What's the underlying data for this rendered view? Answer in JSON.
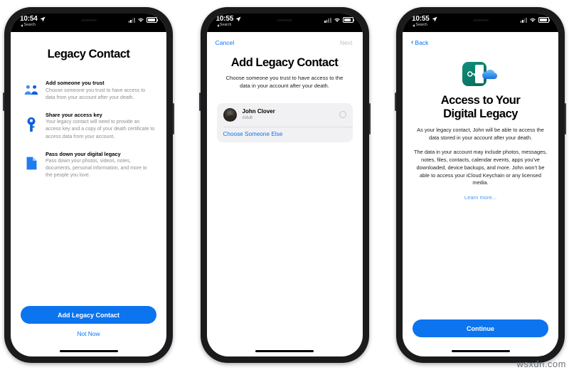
{
  "watermark": "wsxdn.com",
  "colors": {
    "accent": "#0b74ee",
    "link": "#0a74f0",
    "muted": "#8e8e93",
    "card_bg": "#f1f1f3",
    "badge_green": "#0f8f7a",
    "cloud_blue": "#2a8cf0"
  },
  "phones": [
    {
      "status": {
        "time": "10:54",
        "back_label": "Search",
        "location_icon": "location-arrow-icon",
        "signal_icon": "cellular-signal-icon",
        "wifi_icon": "wifi-icon",
        "battery_icon": "battery-icon"
      },
      "title": "Legacy Contact",
      "features": [
        {
          "icon": "two-people-icon",
          "heading": "Add someone you trust",
          "description": "Choose someone you trust to have access to data from your account after your death."
        },
        {
          "icon": "key-icon",
          "heading": "Share your access key",
          "description": "Your legacy contact will need to provide an access key and a copy of your death certificate to access data from your account."
        },
        {
          "icon": "document-icon",
          "heading": "Pass down your digital legacy",
          "description": "Pass down your photos, videos, notes, documents, personal information, and more to the people you love."
        }
      ],
      "primary_button": "Add Legacy Contact",
      "secondary_button": "Not Now"
    },
    {
      "status": {
        "time": "10:55",
        "back_label": "Search",
        "location_icon": "location-arrow-icon",
        "signal_icon": "cellular-signal-icon",
        "wifi_icon": "wifi-icon",
        "battery_icon": "battery-icon"
      },
      "nav_left": "Cancel",
      "nav_right": "Next",
      "title": "Add Legacy Contact",
      "subtitle": "Choose someone you trust to have access to the data in your account after your death.",
      "contact": {
        "name": "John Clover",
        "subtitle": "Adult",
        "avatar": "contact-avatar",
        "selector": "radio-unselected-icon"
      },
      "card_link": "Choose Someone Else"
    },
    {
      "status": {
        "time": "10:55",
        "back_label": "Search",
        "location_icon": "location-arrow-icon",
        "signal_icon": "cellular-signal-icon",
        "wifi_icon": "wifi-icon",
        "battery_icon": "battery-icon"
      },
      "nav_left": "Back",
      "hero_icon": "legacy-key-cloud-icon",
      "title_line1": "Access to Your",
      "title_line2": "Digital Legacy",
      "paragraph1": "As your legacy contact, John will be able to access the data stored in your account after your death.",
      "paragraph2": "The data in your account may include photos, messages, notes, files, contacts, calendar events, apps you’ve downloaded, device backups, and more. John won’t be able to access your iCloud Keychain or any licensed media.",
      "learn_more": "Learn more...",
      "primary_button": "Continue"
    }
  ]
}
